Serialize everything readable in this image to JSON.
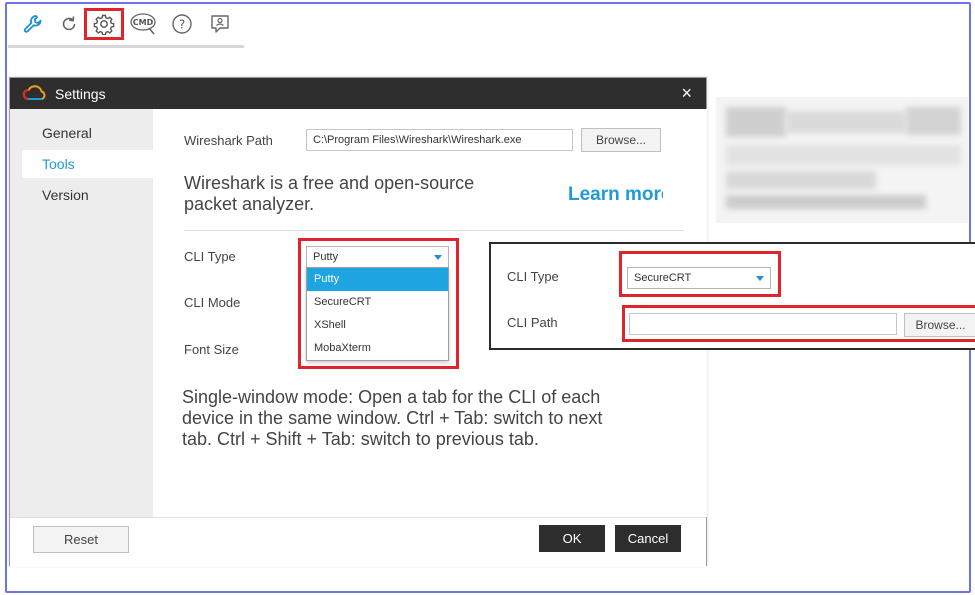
{
  "toolbar": {
    "icons": [
      "wrench-icon",
      "refresh-icon",
      "settings-gear-icon",
      "cmd-icon",
      "help-icon",
      "feedback-icon"
    ],
    "cmd_text": "CMD",
    "help_text": "?"
  },
  "dialog": {
    "title": "Settings",
    "close_glyph": "×",
    "nav": [
      "General",
      "Tools",
      "Version"
    ],
    "active_nav": "Tools",
    "wireshark": {
      "label": "Wireshark Path",
      "value": "C:\\Program Files\\Wireshark\\Wireshark.exe",
      "browse_label": "Browse..."
    },
    "wireshark_description": [
      "Wireshark is a free and open-source",
      "packet analyzer."
    ],
    "learn_more": "Learn more",
    "cli_type_label": "CLI Type",
    "cli_mode_label": "CLI Mode",
    "font_size_label": "Font Size",
    "cli_type_selected": "Putty",
    "cli_type_options": [
      "Putty",
      "SecureCRT",
      "XShell",
      "MobaXterm"
    ],
    "mode_description": [
      "Single-window mode: Open a tab for the CLI of each",
      "device in the same window. Ctrl + Tab: switch to next",
      "tab. Ctrl + Shift + Tab: switch to previous tab."
    ],
    "reset_label": "Reset",
    "ok_label": "OK",
    "cancel_label": "Cancel"
  },
  "side_panel": {
    "cli_type_label": "CLI Type",
    "cli_type_value": "SecureCRT",
    "cli_path_label": "CLI Path",
    "cli_path_value": "",
    "browse_label": "Browse..."
  },
  "colors": {
    "accent": "#1f9bd6",
    "highlight": "#e0242b",
    "titlebar": "#2e2e2e",
    "frame": "#6f73e8"
  }
}
